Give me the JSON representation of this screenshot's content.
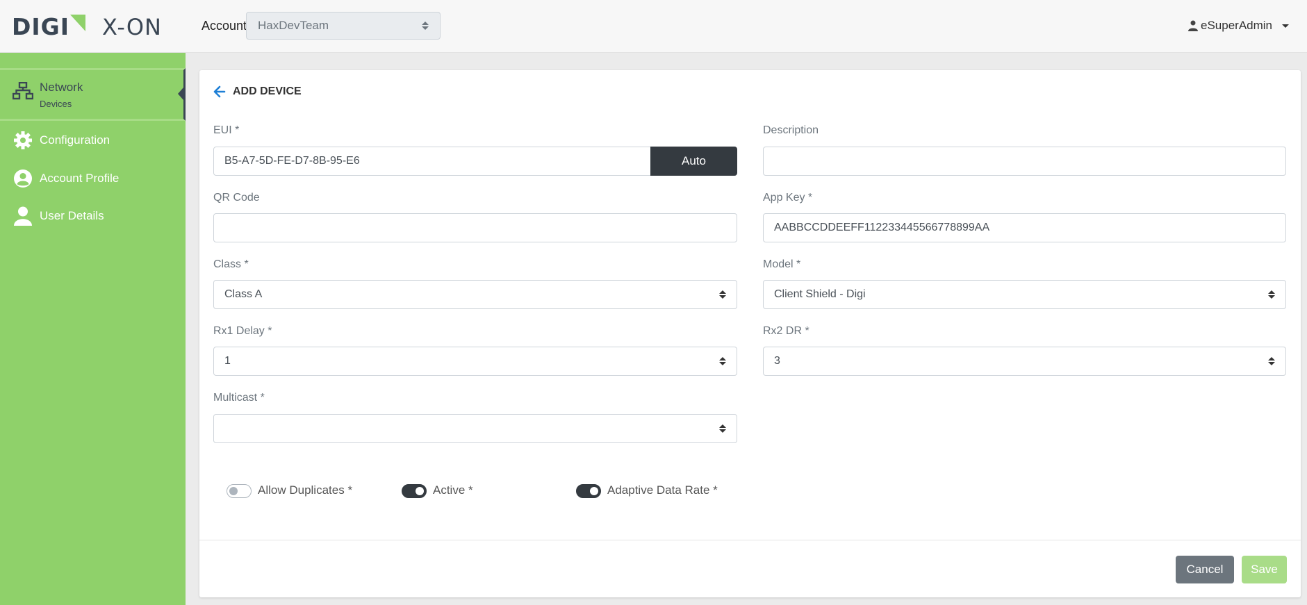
{
  "brand": {
    "left": "DIGI",
    "right": "X-ON",
    "green": "#8fd16a",
    "dark": "#3a4654"
  },
  "header": {
    "account_label": "Account",
    "account_value": "HaxDevTeam",
    "user_name": "eSuperAdmin"
  },
  "sidebar": {
    "active": {
      "label": "Network",
      "sub": "Devices",
      "icon": "network-icon"
    },
    "items": [
      {
        "label": "Configuration",
        "icon": "gear-icon"
      },
      {
        "label": "Account Profile",
        "icon": "user-circle-icon"
      },
      {
        "label": "User Details",
        "icon": "user-icon"
      }
    ]
  },
  "form": {
    "title": "ADD DEVICE",
    "eui": {
      "label": "EUI *",
      "value": "B5-A7-5D-FE-D7-8B-95-E6",
      "auto_label": "Auto"
    },
    "description": {
      "label": "Description",
      "value": ""
    },
    "qr_code": {
      "label": "QR Code",
      "value": ""
    },
    "app_key": {
      "label": "App Key *",
      "value": "AABBCCDDEEFF112233445566778899AA"
    },
    "class": {
      "label": "Class *",
      "value": "Class A"
    },
    "model": {
      "label": "Model *",
      "value": "Client Shield - Digi"
    },
    "rx1_delay": {
      "label": "Rx1 Delay *",
      "value": "1"
    },
    "rx2_dr": {
      "label": "Rx2 DR *",
      "value": "3"
    },
    "multicast": {
      "label": "Multicast *",
      "value": ""
    },
    "toggles": [
      {
        "label": "Allow Duplicates *",
        "on": false
      },
      {
        "label": "Active *",
        "on": true
      },
      {
        "label": "Adaptive Data Rate *",
        "on": true
      }
    ],
    "cancel_label": "Cancel",
    "save_label": "Save"
  }
}
